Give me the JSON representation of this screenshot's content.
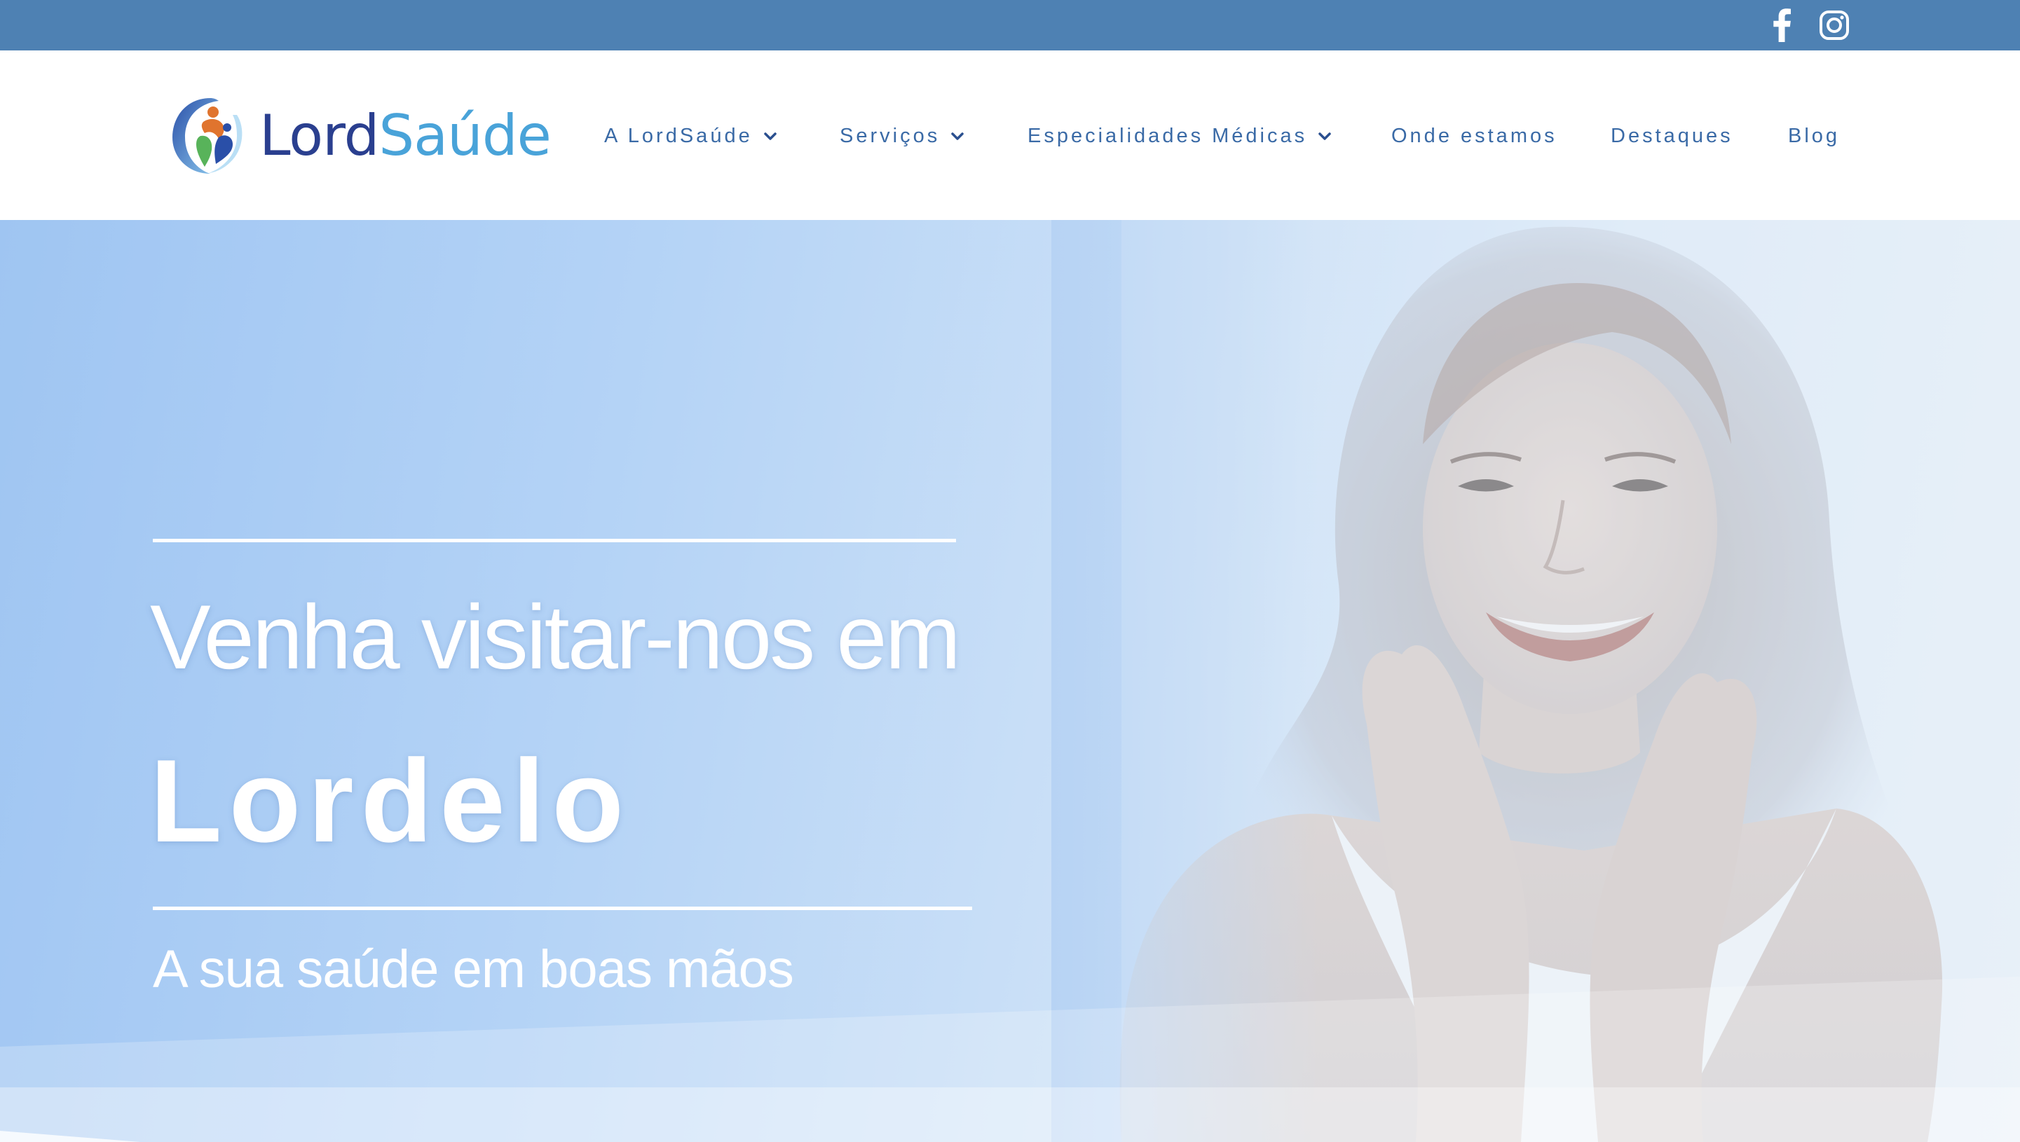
{
  "colors": {
    "topbar": "#4e81b3",
    "nav_text": "#3a6aa6",
    "logo_lord": "#2a3f8f",
    "logo_saude": "#49a3d9",
    "hero_gradient_start": "#9fc5f2",
    "hero_gradient_end": "#edf3f8"
  },
  "topbar": {
    "social": [
      {
        "icon": "facebook-icon"
      },
      {
        "icon": "instagram-icon"
      }
    ]
  },
  "logo": {
    "part1": "Lord",
    "part2": "Saúde"
  },
  "nav": {
    "items": [
      {
        "label": "A LordSaúde",
        "has_dropdown": true
      },
      {
        "label": "Serviços",
        "has_dropdown": true
      },
      {
        "label": "Especialidades Médicas",
        "has_dropdown": true
      },
      {
        "label": "Onde estamos",
        "has_dropdown": false
      },
      {
        "label": "Destaques",
        "has_dropdown": false
      },
      {
        "label": "Blog",
        "has_dropdown": false
      }
    ]
  },
  "hero": {
    "pretitle": "Venha visitar-nos em",
    "title": "Lordelo",
    "subtitle": "A sua saúde em boas mãos"
  }
}
